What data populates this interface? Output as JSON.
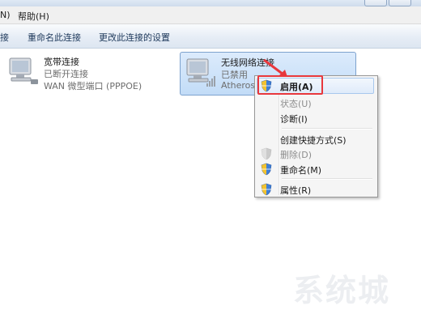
{
  "menubar": {
    "items": [
      {
        "label": "N)"
      },
      {
        "label": "帮助(H)"
      }
    ]
  },
  "toolbar": {
    "buttons": [
      {
        "label": "接"
      },
      {
        "label": "重命名此连接"
      },
      {
        "label": "更改此连接的设置"
      }
    ]
  },
  "connections": [
    {
      "name": "宽带连接",
      "status": "已断开连接",
      "device": "WAN 微型端口 (PPPOE)",
      "icon": "broadband-icon"
    },
    {
      "name": "无线网络连接",
      "status": "已禁用",
      "device": "Atheros",
      "icon": "wireless-adapter-icon",
      "selected": true
    }
  ],
  "context_menu": {
    "items": [
      {
        "label": "启用(A)",
        "shield": true,
        "enabled": true,
        "highlighted": true
      },
      {
        "label": "状态(U)",
        "shield": false,
        "enabled": false
      },
      {
        "label": "诊断(I)",
        "shield": false,
        "enabled": true
      },
      {
        "label": "创建快捷方式(S)",
        "shield": false,
        "enabled": true
      },
      {
        "label": "删除(D)",
        "shield": true,
        "enabled": false
      },
      {
        "label": "重命名(M)",
        "shield": true,
        "enabled": true
      },
      {
        "label": "属性(R)",
        "shield": true,
        "enabled": true
      }
    ]
  },
  "annotation": {
    "color": "#e8383d"
  },
  "watermark": "系统城"
}
